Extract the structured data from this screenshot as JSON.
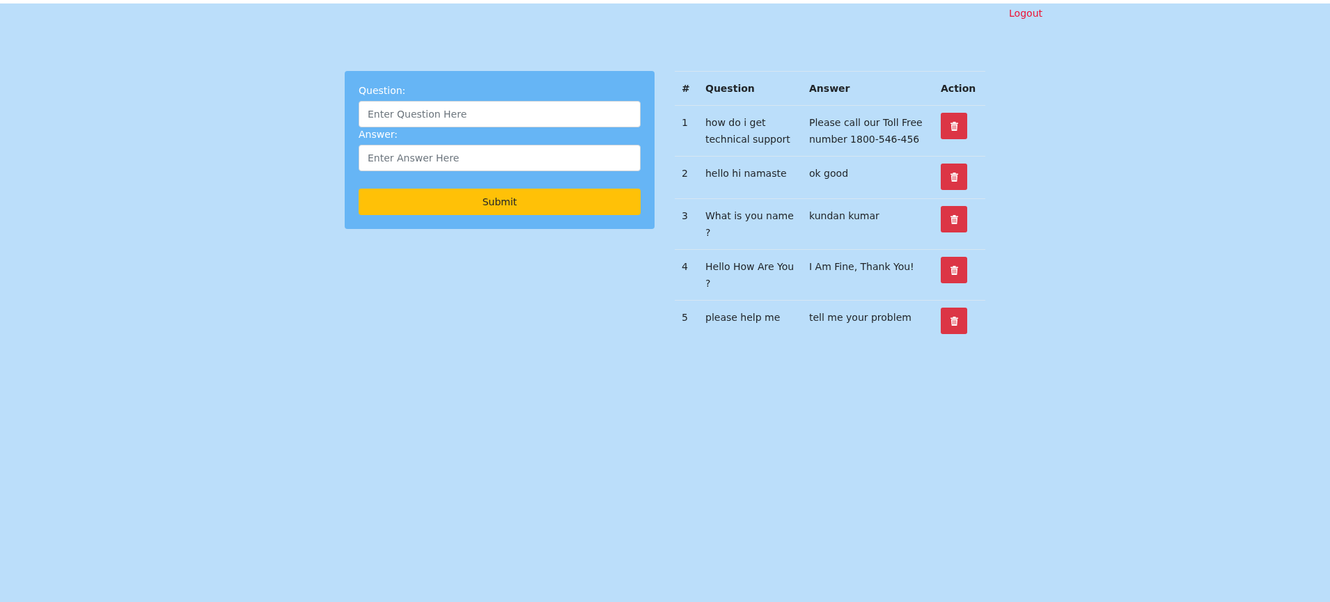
{
  "header": {
    "logout": "Logout"
  },
  "form": {
    "question_label": "Question:",
    "question_placeholder": "Enter Question Here",
    "answer_label": "Answer:",
    "answer_placeholder": "Enter Answer Here",
    "submit": "Submit"
  },
  "table": {
    "columns": [
      "#",
      "Question",
      "Answer",
      "Action"
    ],
    "rows": [
      {
        "number": "1",
        "question": "how do i get technical support",
        "answer": "Please call our Toll Free number 1800-546-456"
      },
      {
        "number": "2",
        "question": "hello hi namaste",
        "answer": "ok good"
      },
      {
        "number": "3",
        "question": "What is you name ?",
        "answer": "kundan kumar"
      },
      {
        "number": "4",
        "question": "Hello How Are You ?",
        "answer": "I Am Fine, Thank You!"
      },
      {
        "number": "5",
        "question": "please help me",
        "answer": "tell me your problem"
      }
    ]
  }
}
